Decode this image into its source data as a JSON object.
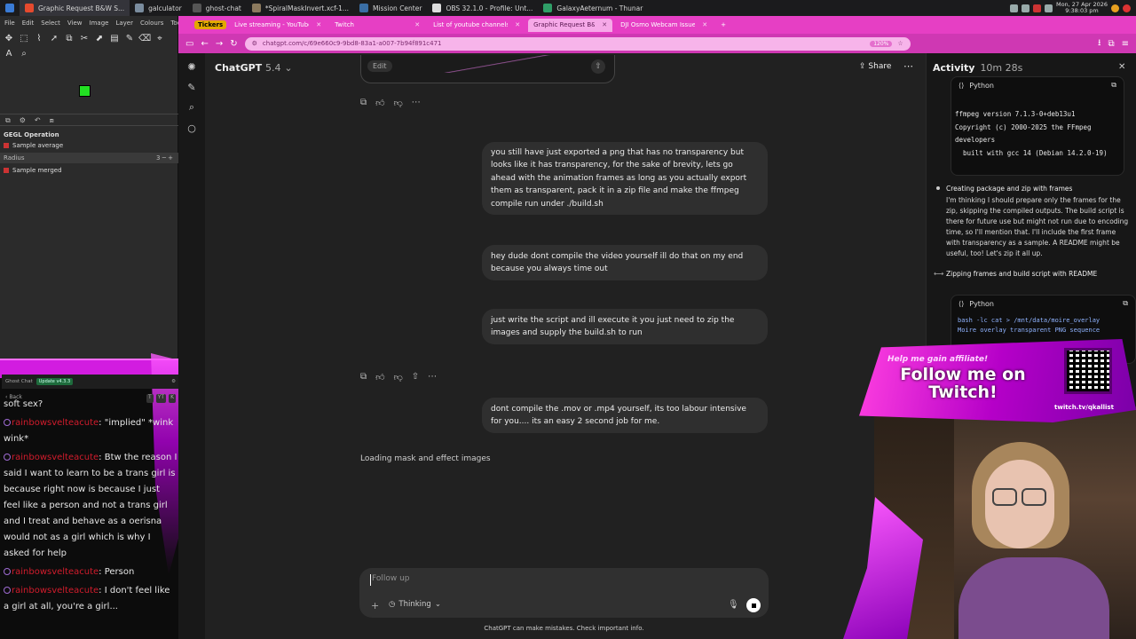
{
  "taskbar": {
    "apps": [
      {
        "label": "Graphic Request B&W S...",
        "color": "#e64a2e",
        "active": true
      },
      {
        "label": "galculator",
        "color": "#7a8c9e",
        "active": false
      },
      {
        "label": "ghost-chat",
        "color": "#555555",
        "active": false
      },
      {
        "label": "*SpiralMaskInvert.xcf-1...",
        "color": "#8c7a5e",
        "active": false
      },
      {
        "label": "Mission Center",
        "color": "#3a6ea5",
        "active": false
      },
      {
        "label": "OBS 32.1.0 - Profile: Unt...",
        "color": "#dddddd",
        "active": false
      },
      {
        "label": "GalaxyAeternum - Thunar",
        "color": "#2f9e67",
        "active": false
      }
    ],
    "clock_date": "Mon, 27 Apr 2026",
    "clock_time": "9:38:03 pm"
  },
  "gimp": {
    "menu": [
      "File",
      "Edit",
      "Select",
      "View",
      "Image",
      "Layer",
      "Colours",
      "Tools"
    ],
    "tools": [
      "✥",
      "⬚",
      "⌇",
      "➚",
      "⧉",
      "✂",
      "⬈",
      "▤",
      "✎",
      "⌫",
      "⌖",
      "A",
      "⌕"
    ],
    "fg_color": "#22e022",
    "panel_tabs": [
      "⧉",
      "⚙",
      "↶",
      "⧈"
    ],
    "gegl_title": "GEGL Operation",
    "sample_average": "Sample average",
    "radius_label": "Radius",
    "radius_value": "3",
    "sample_merged": "Sample merged"
  },
  "chat_overlay": {
    "title": "Ghost Chat",
    "update": "Update v4.3.3",
    "back": "Back",
    "controls": [
      "T",
      "YT",
      "K"
    ],
    "top_partial": "soft sex?",
    "messages": [
      {
        "user": "rainbowsvelteacute",
        "text": "\"implied\" *wink wink*"
      },
      {
        "user": "rainbowsvelteacute",
        "text": "Btw the reason I said I want to learn to be a trans girl is because right now is because I just feel like a person and not a trans girl and I treat and behave as a oerisna would not as a girl which is why I asked for help"
      },
      {
        "user": "rainbowsvelteacute",
        "text": "Person"
      },
      {
        "user": "rainbowsvelteacute",
        "text": "I don't feel like a girl at all, you're a girl..."
      }
    ],
    "ok": "OK"
  },
  "browser": {
    "tickers": "Tickers",
    "tabs": [
      {
        "label": "Live streaming - YouTube",
        "active": false
      },
      {
        "label": "Twitch",
        "active": false
      },
      {
        "label": "List of youtube channels a...",
        "active": false
      },
      {
        "label": "Graphic Request B&W Sep...",
        "active": true
      },
      {
        "label": "DJI Osmo Webcam Issue",
        "active": false
      }
    ],
    "url": "chatgpt.com/c/69e660c9-9bd8-83a1-a007-7b94f891c471",
    "zoom": "120%"
  },
  "chatgpt": {
    "title": "ChatGPT",
    "version": "5.4",
    "share": "Share",
    "edit": "Edit",
    "messages": [
      "you still have just exported a png that has no transparency but looks like it has transparency, for the sake of brevity, lets go ahead with the animation frames as long as you actually export them as transparent, pack it in a zip file and make the ffmpeg compile run under ./build.sh",
      "hey dude dont compile the video yourself ill do that on my end because you always time out",
      "just write the script and ill execute it you just need to zip the images and supply the build.sh to run",
      "dont compile the .mov or .mp4 yourself, its too labour intensive for you.... its an easy 2 second job for me."
    ],
    "thinking_status": "Loading mask and effect images",
    "composer_placeholder": "Follow up",
    "thinking_mode": "Thinking",
    "disclaimer": "ChatGPT can make mistakes. Check important info."
  },
  "activity": {
    "title": "Activity",
    "elapsed": "10m 28s",
    "code1_lang": "Python",
    "code1_output": "ffmpeg version 7.1.3-0+deb13u1\nCopyright (c) 2000-2025 the FFmpeg developers\n  built with gcc 14 (Debian 14.2.0-19)",
    "step1_title": "Creating package and zip with frames",
    "step1_body": "I'm thinking I should prepare only the frames for the zip, skipping the compiled outputs. The build script is there for future use but might not run due to encoding time, so I'll mention that. I'll include the first frame with transparency as a sample. A README might be useful, too! Let's zip it all up.",
    "step2_title": "Zipping frames and build script with README",
    "code2_lang": "Python",
    "code2_text": "bash -lc cat > /mnt/data/moire_overlay\nMoire overlay transparent PNG sequence\n\nContents:"
  },
  "stream_overlay": {
    "tagline": "Help me gain affiliate!",
    "follow_line1": "Follow me on",
    "follow_line2": "Twitch!",
    "twitch_url": "twitch.tv/qkallist"
  }
}
